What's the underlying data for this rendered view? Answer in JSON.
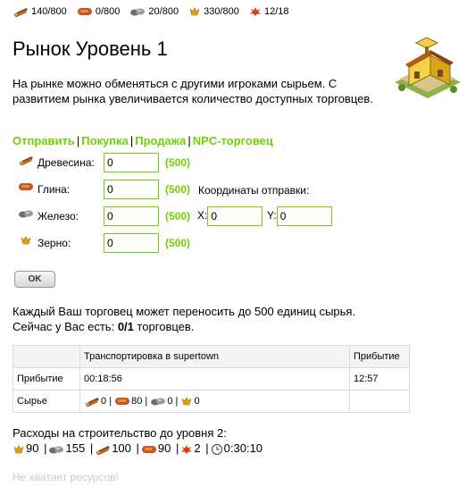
{
  "resources": [
    {
      "icon": "wood-icon",
      "value": "140/800"
    },
    {
      "icon": "clay-icon",
      "value": "0/800"
    },
    {
      "icon": "iron-icon",
      "value": "20/800"
    },
    {
      "icon": "crop-icon",
      "value": "330/800"
    },
    {
      "icon": "crop-consumption-icon",
      "value": "12/18"
    }
  ],
  "title": "Рынок Уровень 1",
  "description": "На рынке можно обменяться с другими игроками сырьем. С развитием рынка увеличивается количество доступных торговцев.",
  "tabs": {
    "send": "Отправить",
    "buy": "Покупка",
    "sell": "Продажа",
    "npc": "NPC-торговец",
    "sep": "|"
  },
  "form": {
    "rows": [
      {
        "label": "Древесина:",
        "value": "0",
        "max": "(500)"
      },
      {
        "label": "Глина:",
        "value": "0",
        "max": "(500)"
      },
      {
        "label": "Железо:",
        "value": "0",
        "max": "(500)"
      },
      {
        "label": "Зерно:",
        "value": "0",
        "max": "(500)"
      }
    ],
    "coords_label": "Координаты отправки:",
    "x_label": "X:",
    "x_value": "0",
    "y_label": "Y:",
    "y_value": "0",
    "ok_label": "OK"
  },
  "info": {
    "line1": "Каждый Ваш торговец может переносить до 500 единиц сырья.",
    "line2_prefix": "Сейчас у Вас есть: ",
    "line2_count": "0/1",
    "line2_suffix": " торговцев."
  },
  "trade_table": {
    "header": {
      "col1": "",
      "col2": "Транспортировка в supertown",
      "col3": "Прибытие"
    },
    "arrival_label": "Прибытие",
    "duration": "00:18:56",
    "arrival_time": "12:57",
    "resources_label": "Сырье",
    "res_values": [
      "0",
      "80",
      "0",
      "0"
    ],
    "sep": "|"
  },
  "costs": {
    "heading": "Расходы на строительство до уровня 2:",
    "items": [
      {
        "icon": "crop-icon",
        "value": "90"
      },
      {
        "icon": "iron-icon",
        "value": "155"
      },
      {
        "icon": "wood-icon",
        "value": "100"
      },
      {
        "icon": "clay-icon",
        "value": "90"
      },
      {
        "icon": "crop-consumption-icon",
        "value": "2"
      },
      {
        "icon": "clock-icon",
        "value": "0:30:10"
      }
    ],
    "sep": "|"
  },
  "warning": "Не хватает ресурсов!",
  "colors": {
    "accent": "#71d000",
    "disabled_text": "#c9c9c9",
    "border": "#dcdcdc"
  }
}
